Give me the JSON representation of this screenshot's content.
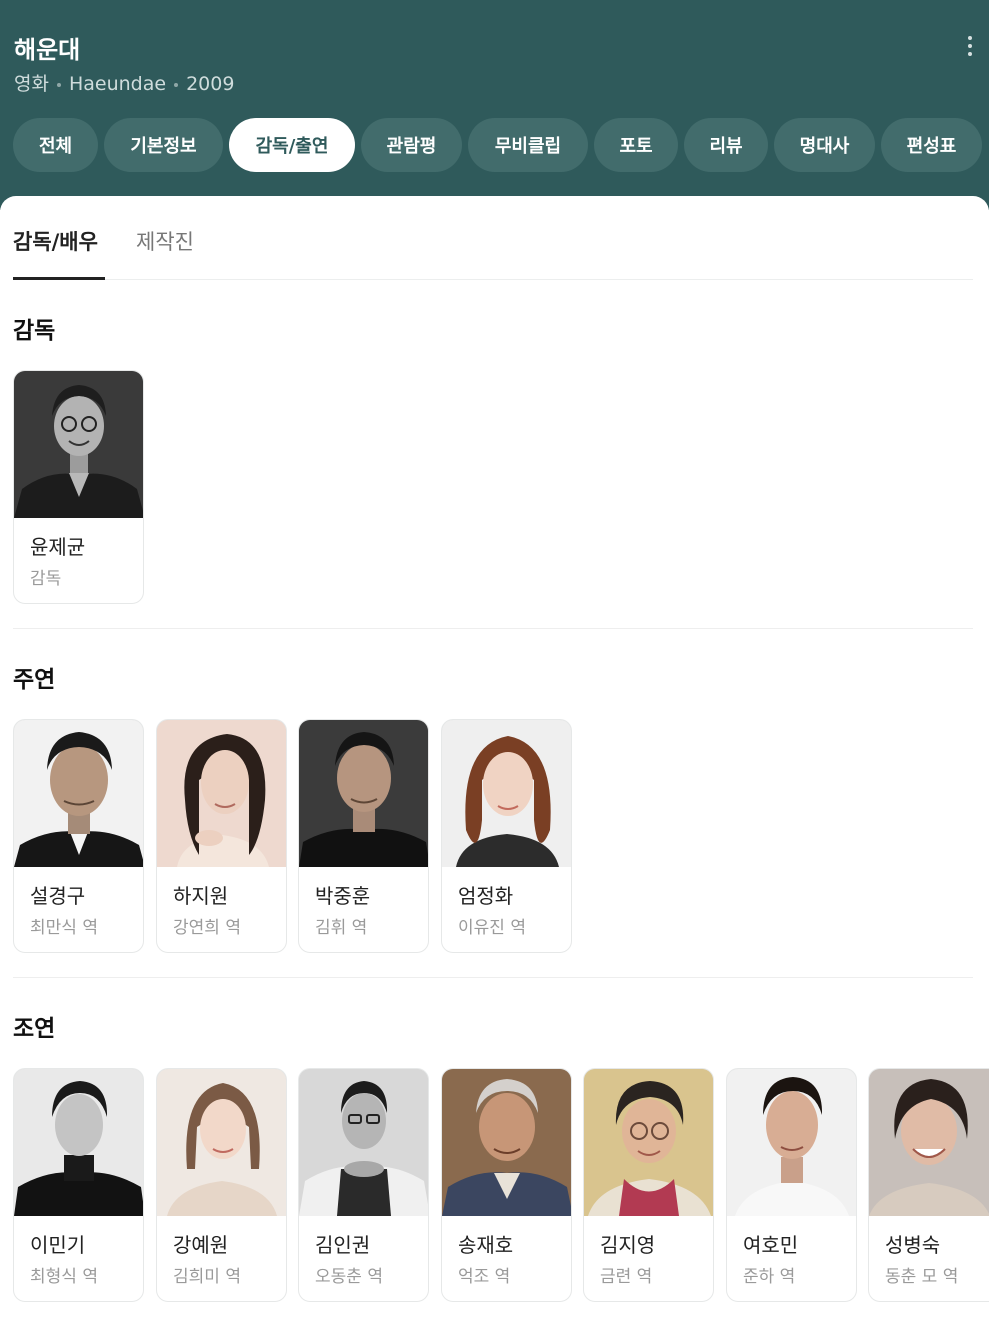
{
  "header": {
    "title": "해운대",
    "meta": [
      "영화",
      "Haeundae",
      "2009"
    ],
    "menu_icon": "more-vertical-icon"
  },
  "tabs": [
    {
      "label": "전체",
      "active": false
    },
    {
      "label": "기본정보",
      "active": false
    },
    {
      "label": "감독/출연",
      "active": true
    },
    {
      "label": "관람평",
      "active": false
    },
    {
      "label": "무비클립",
      "active": false
    },
    {
      "label": "포토",
      "active": false
    },
    {
      "label": "리뷰",
      "active": false
    },
    {
      "label": "명대사",
      "active": false
    },
    {
      "label": "편성표",
      "active": false
    }
  ],
  "subtabs": [
    {
      "label": "감독/배우",
      "active": true
    },
    {
      "label": "제작진",
      "active": false
    }
  ],
  "sections": {
    "director": {
      "title": "감독",
      "people": [
        {
          "name": "윤제균",
          "role": "감독"
        }
      ]
    },
    "lead": {
      "title": "주연",
      "people": [
        {
          "name": "설경구",
          "role": "최만식 역"
        },
        {
          "name": "하지원",
          "role": "강연희 역"
        },
        {
          "name": "박중훈",
          "role": "김휘 역"
        },
        {
          "name": "엄정화",
          "role": "이유진 역"
        }
      ]
    },
    "supporting": {
      "title": "조연",
      "people": [
        {
          "name": "이민기",
          "role": "최형식 역"
        },
        {
          "name": "강예원",
          "role": "김희미 역"
        },
        {
          "name": "김인권",
          "role": "오동춘 역"
        },
        {
          "name": "송재호",
          "role": "억조 역"
        },
        {
          "name": "김지영",
          "role": "금련 역"
        },
        {
          "name": "여호민",
          "role": "준하 역"
        },
        {
          "name": "성병숙",
          "role": "동춘 모 역"
        }
      ]
    }
  },
  "colors": {
    "header_bg": "#2f5a5b",
    "tab_bg": "#426c6c",
    "active_tab_bg": "#ffffff",
    "active_tab_text": "#2f5a5b"
  }
}
